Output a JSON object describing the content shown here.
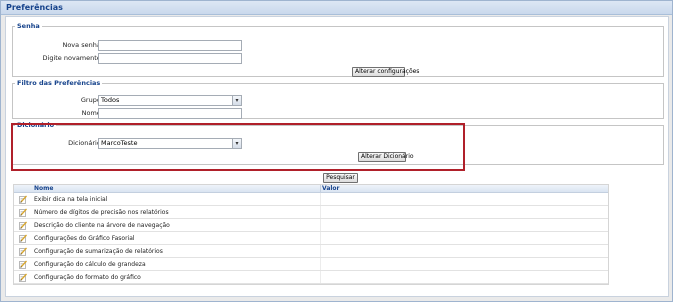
{
  "panel": {
    "title": "Preferências"
  },
  "senha": {
    "legend": "Senha",
    "nova_label": "Nova senha:",
    "nova_value": "",
    "repita_label": "Digite novamente:",
    "repita_value": "",
    "button": "Alterar configurações"
  },
  "filtro": {
    "legend": "Filtro das Preferências",
    "grupo_label": "Grupo:",
    "grupo_value": "Todos",
    "nome_label": "Nome:",
    "nome_value": ""
  },
  "dicionario": {
    "legend": "Dicionário",
    "label": "Dicionário:",
    "value": "MarcoTeste",
    "button": "Alterar Dicionário"
  },
  "pesquisar": "Pesquisar",
  "grid": {
    "columns": [
      "Nome",
      "Valor"
    ],
    "rows": [
      {
        "nome": "Exibir dica na tela inicial",
        "valor": ""
      },
      {
        "nome": "Número de dígitos de precisão nos relatórios",
        "valor": ""
      },
      {
        "nome": "Descrição do cliente na árvore de navegação",
        "valor": ""
      },
      {
        "nome": "Configurações do Gráfico Fasorial",
        "valor": ""
      },
      {
        "nome": "Configuração de sumarização de relatórios",
        "valor": ""
      },
      {
        "nome": "Configuração do cálculo de grandeza",
        "valor": ""
      },
      {
        "nome": "Configuração do formato do gráfico",
        "valor": ""
      }
    ]
  },
  "colors": {
    "header_text": "#15428b",
    "highlight_border": "#b0202a",
    "icon": "#d9a62b"
  },
  "icons": {
    "row_icon": "edit-pencil-icon",
    "select_arrow": "chevron-down-icon"
  }
}
